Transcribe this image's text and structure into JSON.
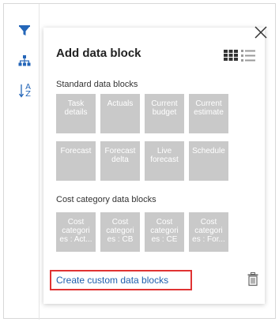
{
  "panel": {
    "title": "Add data block",
    "close_label": "Close"
  },
  "sections": {
    "standard": {
      "label": "Standard data blocks",
      "tiles": [
        "Task details",
        "Actuals",
        "Current budget",
        "Current estimate",
        "Forecast",
        "Forecast delta",
        "Live forecast",
        "Schedule"
      ]
    },
    "cost_category": {
      "label": "Cost category data blocks",
      "tiles": [
        "Cost categori es : Act...",
        "Cost categori es : CB",
        "Cost categori es : CE",
        "Cost categori es : For..."
      ]
    }
  },
  "footer": {
    "create_link": "Create custom data blocks"
  },
  "rail": {
    "icons": [
      "filter-icon",
      "hierarchy-icon",
      "sort-az-icon"
    ],
    "sort_glyph_top": "A",
    "sort_glyph_bottom": "Z"
  },
  "colors": {
    "accent": "#2466b8",
    "tile": "#c9c9c9",
    "highlight_border": "#e03333",
    "link": "#1f5fae"
  }
}
